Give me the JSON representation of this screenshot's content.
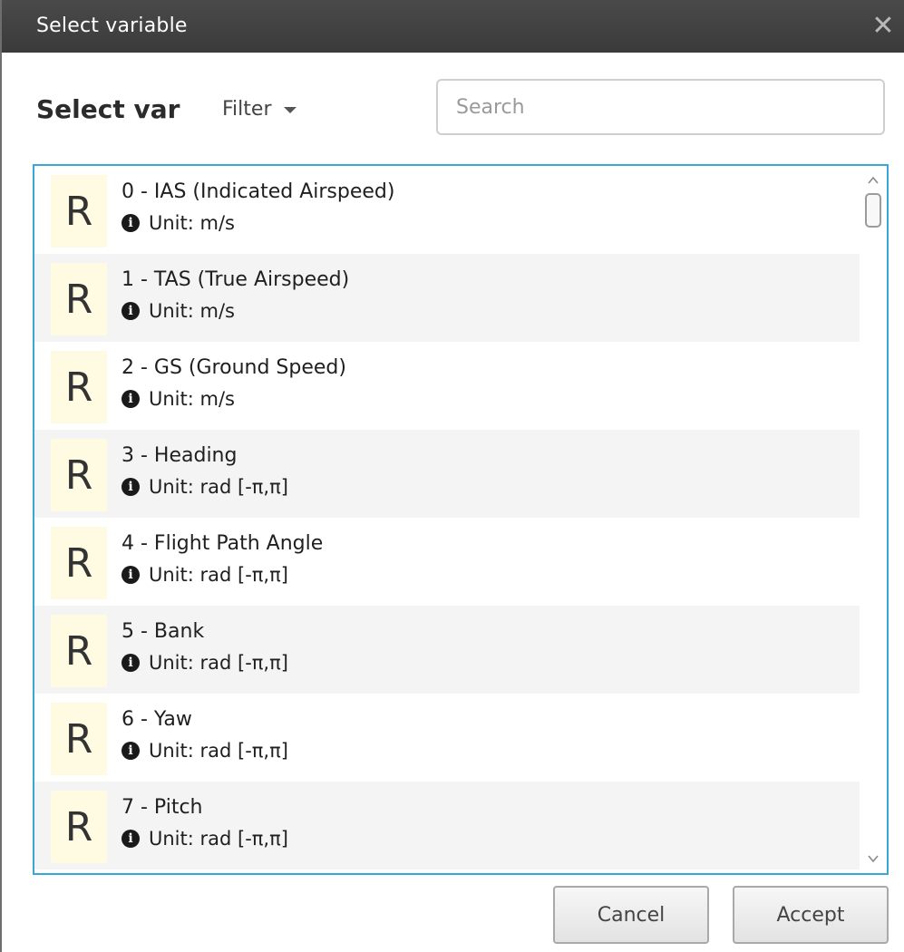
{
  "window": {
    "title": "Select variable",
    "close_glyph": "✕"
  },
  "header": {
    "heading": "Select var",
    "filter_label": "Filter",
    "search_placeholder": "Search",
    "search_value": ""
  },
  "list": {
    "badge_letter": "R",
    "info_glyph": "i",
    "items": [
      {
        "name": "0 - IAS (Indicated Airspeed)",
        "unit": "Unit: m/s"
      },
      {
        "name": "1 - TAS (True Airspeed)",
        "unit": "Unit: m/s"
      },
      {
        "name": "2 - GS (Ground Speed)",
        "unit": "Unit: m/s"
      },
      {
        "name": "3 - Heading",
        "unit": "Unit: rad [-π,π]"
      },
      {
        "name": "4 - Flight Path Angle",
        "unit": "Unit: rad [-π,π]"
      },
      {
        "name": "5 - Bank",
        "unit": "Unit: rad [-π,π]"
      },
      {
        "name": "6 - Yaw",
        "unit": "Unit: rad [-π,π]"
      },
      {
        "name": "7 - Pitch",
        "unit": "Unit: rad [-π,π]"
      }
    ]
  },
  "footer": {
    "cancel_label": "Cancel",
    "accept_label": "Accept"
  },
  "colors": {
    "titlebar": "#3f3f3f",
    "list_border": "#3aa7d8",
    "badge_bg": "#fefbe2",
    "alt_row_bg": "#f4f4f4"
  }
}
